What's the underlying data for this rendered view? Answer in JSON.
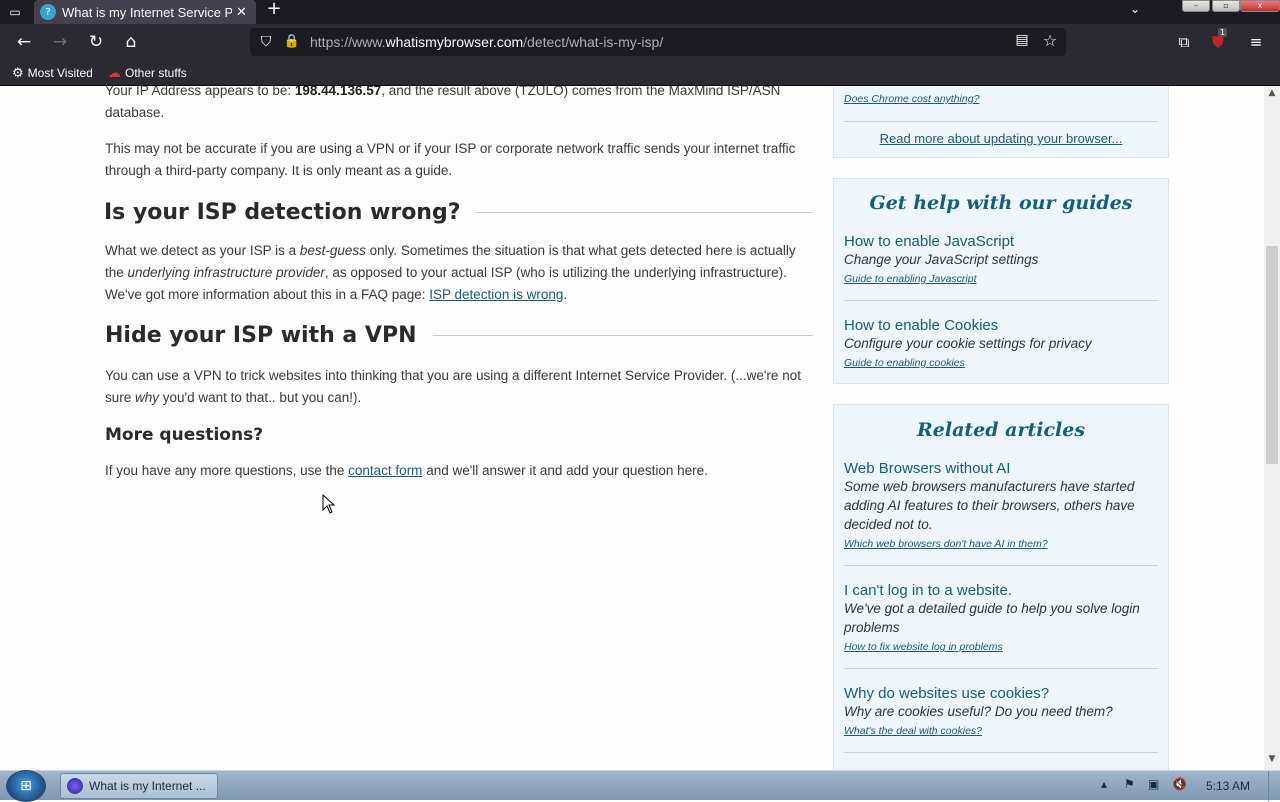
{
  "browser": {
    "tab_title": "What is my Internet Service Provider",
    "tab_close": "✕",
    "new_tab": "+",
    "url_scheme": "https://www.",
    "url_host": "whatismybrowser.com",
    "url_path": "/detect/what-is-my-isp/",
    "ublock_count": "1",
    "bookmarks": [
      {
        "label": "Most Visited",
        "icon": "gear-icon"
      },
      {
        "label": "Other stuffs",
        "icon": "folder-icon"
      }
    ]
  },
  "main": {
    "ip_para": {
      "prefix": "Your IP Address appears to be: ",
      "ip": "198.44.136.57",
      "suffix": ", and the result above (TZULO) comes from the MaxMind ISP/ASN database."
    },
    "vpn_note": "This may not be accurate if you are using a VPN or if your ISP or corporate network traffic sends your internet traffic through a third-party company. It is only meant as a guide.",
    "section1": {
      "heading": "Is your ISP detection wrong?",
      "p1": "What we detect as your ISP is a ",
      "em1": "best-guess",
      "p2": " only. Sometimes the situation is that what gets detected here is actually the ",
      "em2": "underlying infrastructure provider",
      "p3": ", as opposed to your actual ISP (who is utilizing the underlying infrastructure). We've got more information about this in a FAQ page: ",
      "link": "ISP detection is wrong",
      "p4": "."
    },
    "section2": {
      "heading": "Hide your ISP with a VPN",
      "p1": "You can use a VPN to trick websites into thinking that you are using a different Internet Service Provider. (...we're not sure ",
      "em": "why",
      "p2": " you'd want to that.. but you can!)."
    },
    "section3": {
      "heading": "More questions?",
      "p1": "If you have any more questions, use the ",
      "link": "contact form",
      "p2": " and we'll answer it and add your question here."
    }
  },
  "sidebar": {
    "update_box": {
      "link1": "Does Chrome cost anything?",
      "link2": "Read more about updating your browser..."
    },
    "guides": {
      "title": "Get help with our guides",
      "items": [
        {
          "title": "How to enable JavaScript",
          "desc": "Change your JavaScript settings",
          "link": "Guide to enabling Javascript"
        },
        {
          "title": "How to enable Cookies",
          "desc": "Configure your cookie settings for privacy",
          "link": "Guide to enabling cookies"
        }
      ]
    },
    "related": {
      "title": "Related articles",
      "items": [
        {
          "title": "Web Browsers without AI",
          "desc": "Some web browsers manufacturers have started adding AI features to their browsers, others have decided not to.",
          "link": "Which web browsers don't have AI in them?"
        },
        {
          "title": "I can't log in to a website.",
          "desc": "We've got a detailed guide to help you solve login problems",
          "link": "How to fix website log in problems"
        },
        {
          "title": "Why do websites use cookies?",
          "desc": "Why are cookies useful? Do you need them?",
          "link": "What's the deal with cookies?"
        }
      ]
    }
  },
  "taskbar": {
    "task_label": "What is my Internet ...",
    "clock": "5:13 AM"
  }
}
